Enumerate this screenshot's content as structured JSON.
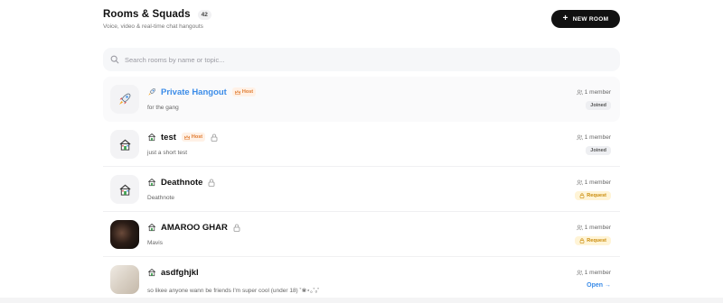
{
  "header": {
    "title": "Rooms & Squads",
    "count": "42",
    "subtitle": "Voice, video & real-time chat hangouts",
    "new_room_label": "NEW ROOM"
  },
  "search": {
    "placeholder": "Search rooms by name or topic..."
  },
  "rooms": [
    {
      "name": "Private Hangout",
      "emoji": "rocket-icon",
      "host": "Host",
      "locked": false,
      "description": "for the gang",
      "members": "1 member",
      "status": "Joined",
      "name_color": "#3b8ce8"
    },
    {
      "name": "test",
      "emoji": "house-icon",
      "host": "Host",
      "locked": true,
      "description": "just a short test",
      "members": "1 member",
      "status": "Joined"
    },
    {
      "name": "Deathnote",
      "emoji": "house-icon",
      "host": "",
      "locked": true,
      "description": "Deathnote",
      "members": "1 member",
      "status": "Request"
    },
    {
      "name": "AMAROO GHAR",
      "emoji": "house-icon",
      "host": "",
      "locked": true,
      "description": "Mavis",
      "members": "1 member",
      "status": "Request"
    },
    {
      "name": "asdfghjkl",
      "emoji": "house-icon",
      "host": "",
      "locked": false,
      "description": "so likee anyone wann be friends I'm super cool (under 18) ˚❀⋆｡˚ₒ˚",
      "members": "1 member",
      "status": "Open →"
    }
  ],
  "colors": {
    "accent_blue": "#3b8ce8",
    "host_orange": "#e07a2e",
    "request_yellow": "#fff4d6",
    "button_black": "#111111"
  }
}
